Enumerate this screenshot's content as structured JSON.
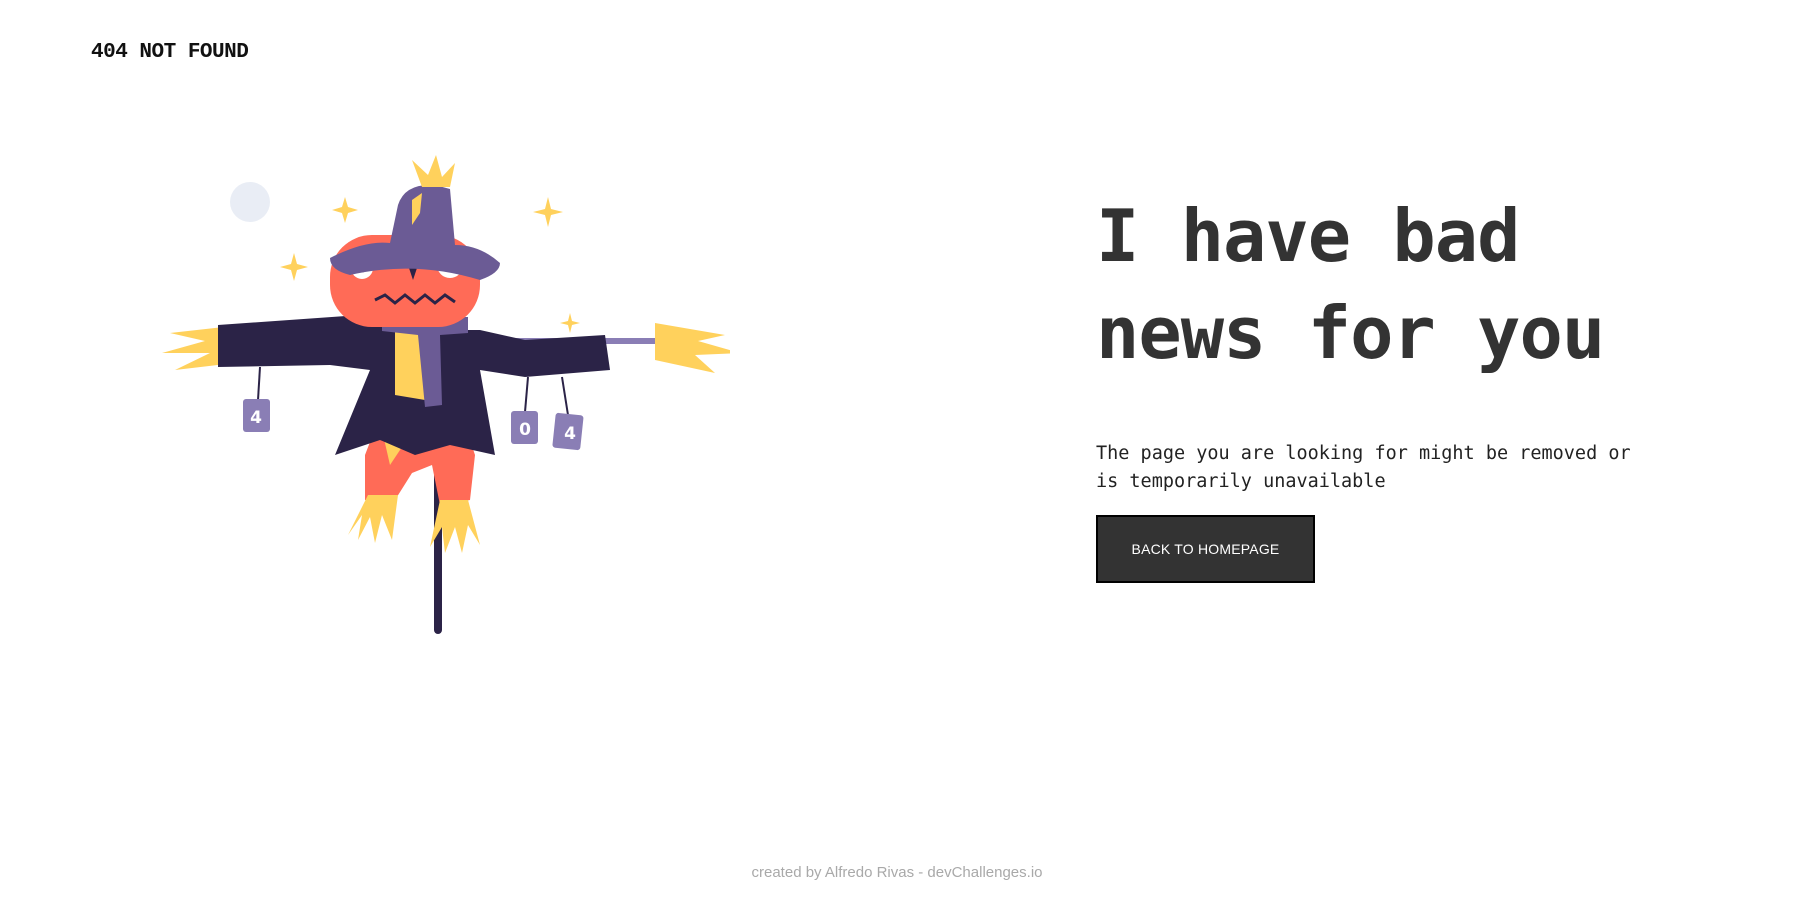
{
  "header": {
    "brand": "404 NOT FOUND"
  },
  "illustration": {
    "icon": "scarecrow-illustration",
    "tags": [
      "4",
      "0",
      "4"
    ],
    "colors": {
      "hat": "#6B5B95",
      "coat": "#2B2347",
      "body": "#FF6B57",
      "straw": "#FFD15C",
      "moon": "#E9EDF5",
      "tag": "#8A7EB5"
    }
  },
  "main": {
    "headline_line1": "I have bad",
    "headline_line2": "news for you",
    "description": "The page you are looking for might be removed or is temporarily unavailable",
    "button_label": "BACK TO HOMEPAGE"
  },
  "footer": {
    "credit": "created by Alfredo Rivas - devChallenges.io"
  },
  "colors": {
    "text": "#333333",
    "button_bg": "#333333",
    "button_text": "#ffffff",
    "footer_text": "#a9a9a9"
  }
}
